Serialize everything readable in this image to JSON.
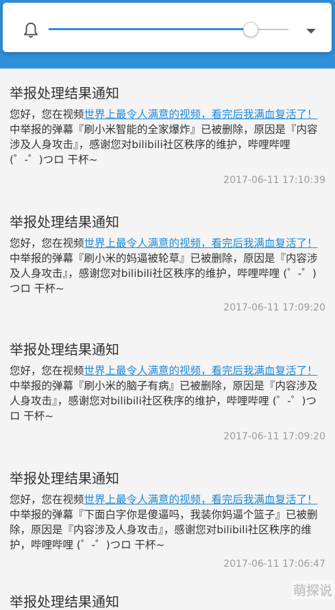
{
  "colors": {
    "header_blue": "#2f8fd8",
    "slider_blue": "#2b8fd6",
    "link_blue": "#1f8ad8",
    "text": "#333333",
    "timestamp": "#9a9a9a",
    "background": "#f4f4f4"
  },
  "volume_panel": {
    "bell_icon": "bell-icon",
    "slider_level": 0.84,
    "dropdown_icon": "triangle-down-icon"
  },
  "notifications": [
    {
      "title": "举报处理结果通知",
      "prefix": "您好，您在视频",
      "video_link": "世界上最令人满意的视频，看完后我满血复活了！",
      "body": "中举报的弹幕『刷小米智能的全家爆炸』已被删除，原因是『内容涉及人身攻击』，感谢您对bilibili社区秩序的维护，哔哩哔哩 (゜-゜)つロ 干杯~",
      "time": "2017-06-11 17:10:39"
    },
    {
      "title": "举报处理结果通知",
      "prefix": "您好，您在视频",
      "video_link": "世界上最令人满意的视频，看完后我满血复活了！",
      "body": "中举报的弹幕『刷小米的妈逼被轮草』已被删除，原因是『内容涉及人身攻击』，感谢您对bilibili社区秩序的维护，哔哩哔哩 (゜-゜)つロ 干杯~",
      "time": "2017-06-11 17:09:20"
    },
    {
      "title": "举报处理结果通知",
      "prefix": "您好，您在视频",
      "video_link": "世界上最令人满意的视频，看完后我满血复活了！",
      "body": "中举报的弹幕『刷小米的脑子有病』已被删除，原因是『内容涉及人身攻击』，感谢您对bilibili社区秩序的维护，哔哩哔哩 (゜-゜)つロ 干杯~",
      "time": "2017-06-11 17:09:20"
    },
    {
      "title": "举报处理结果通知",
      "prefix": "您好，您在视频",
      "video_link": "世界上最令人满意的视频，看完后我满血复活了！",
      "body": "中举报的弹幕『下面白字你是傻逼吗，我装你妈逼个篮子』已被删除，原因是『内容涉及人身攻击』，感谢您对bilibili社区秩序的维护，哔哩哔哩 (゜-゜)つロ 干杯~",
      "time": "2017-06-11 17:06:47"
    },
    {
      "title": "举报处理结果通知"
    }
  ],
  "watermark": "萌探说"
}
